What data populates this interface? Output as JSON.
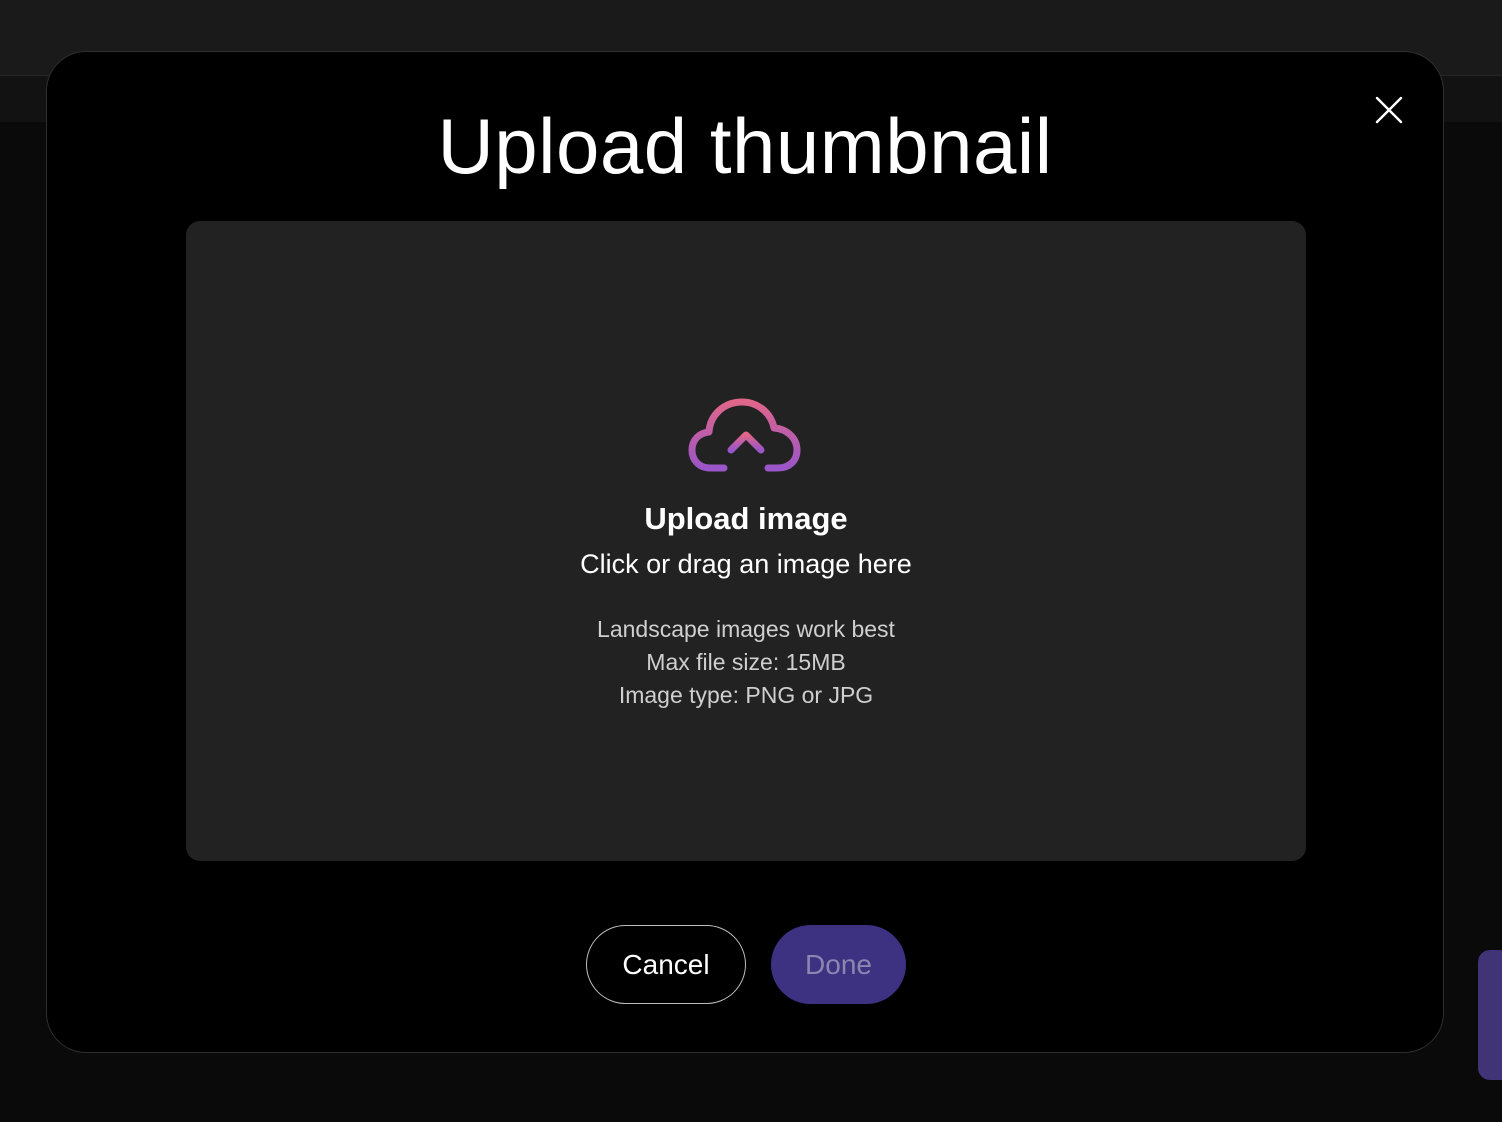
{
  "modal": {
    "title": "Upload thumbnail",
    "close_icon": "close-icon"
  },
  "dropzone": {
    "icon": "cloud-upload-icon",
    "title": "Upload image",
    "subtitle": "Click or drag an image here",
    "hints": [
      "Landscape images work best",
      "Max file size: 15MB",
      "Image type: PNG or JPG"
    ]
  },
  "actions": {
    "cancel_label": "Cancel",
    "done_label": "Done",
    "done_enabled": false
  },
  "colors": {
    "accent": "#3d3182",
    "icon_gradient_start": "#e0668a",
    "icon_gradient_end": "#9a55c8",
    "dropzone_bg": "#222222"
  }
}
